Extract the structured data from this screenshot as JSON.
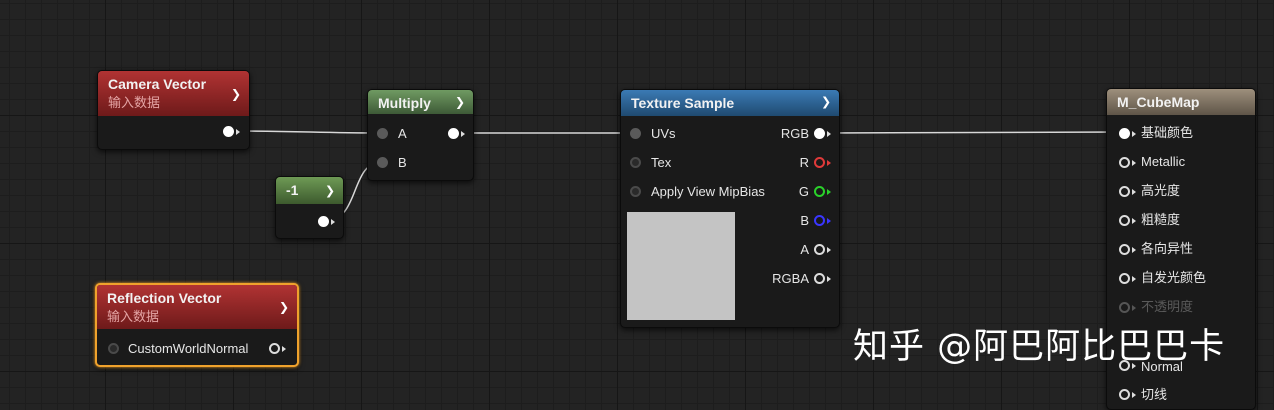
{
  "nodes": {
    "camera_vector": {
      "title": "Camera Vector",
      "subtitle": "输入数据"
    },
    "multiply": {
      "title": "Multiply",
      "pins": {
        "a": "A",
        "b": "B"
      }
    },
    "constant": {
      "title": "-1"
    },
    "reflection_vector": {
      "title": "Reflection Vector",
      "subtitle": "输入数据",
      "pins": {
        "custom_world_normal": "CustomWorldNormal"
      }
    },
    "texture_sample": {
      "title": "Texture Sample",
      "inputs": {
        "uvs": "UVs",
        "tex": "Tex",
        "apply_view_mip_bias": "Apply View MipBias"
      },
      "outputs": {
        "rgb": "RGB",
        "r": "R",
        "g": "G",
        "b": "B",
        "a": "A",
        "rgba": "RGBA"
      }
    },
    "material": {
      "title": "M_CubeMap",
      "inputs": [
        "基础颜色",
        "Metallic",
        "高光度",
        "粗糙度",
        "各向异性",
        "自发光颜色",
        "不透明度",
        "Normal",
        "切线"
      ]
    }
  },
  "watermark": "知乎 @阿巴阿比巴巴卡",
  "colors": {
    "selection": "#f0a22c",
    "pin_r": "#e03a3a",
    "pin_g": "#2ad12a",
    "pin_b": "#3a36ff"
  },
  "icons": {
    "collapse": "chevron-down-icon",
    "expand": "chevron-up-icon"
  }
}
